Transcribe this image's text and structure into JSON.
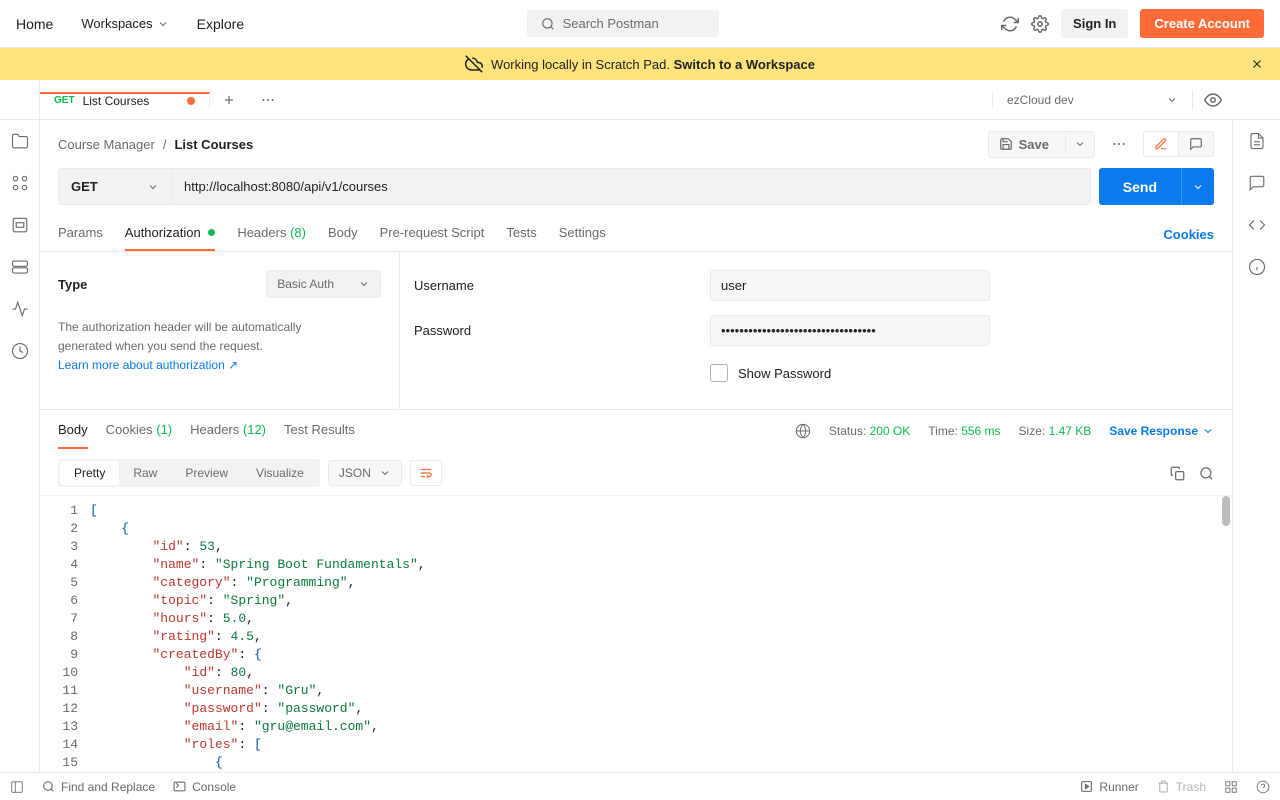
{
  "nav": {
    "home": "Home",
    "workspaces": "Workspaces",
    "explore": "Explore",
    "search_placeholder": "Search Postman",
    "signin": "Sign In",
    "create_account": "Create Account"
  },
  "banner": {
    "text": "Working locally in Scratch Pad.",
    "link": "Switch to a Workspace"
  },
  "tab": {
    "method": "GET",
    "title": "List Courses"
  },
  "env": {
    "name": "ezCloud dev"
  },
  "breadcrumb": {
    "parent": "Course Manager",
    "current": "List Courses"
  },
  "toolbar": {
    "save": "Save"
  },
  "request": {
    "method": "GET",
    "url": "http://localhost:8080/api/v1/courses",
    "send": "Send"
  },
  "reqTabs": {
    "params": "Params",
    "auth": "Authorization",
    "headers": "Headers",
    "headers_count": "(8)",
    "body": "Body",
    "prerequest": "Pre-request Script",
    "tests": "Tests",
    "settings": "Settings",
    "cookies": "Cookies"
  },
  "auth": {
    "type_label": "Type",
    "type_value": "Basic Auth",
    "desc1": "The authorization header will be automatically",
    "desc2": "generated when you send the request.",
    "learn": "Learn more about authorization ↗",
    "username_label": "Username",
    "username_value": "user",
    "password_label": "Password",
    "password_value": "••••••••••••••••••••••••••••••••••",
    "show_pw": "Show Password"
  },
  "respTabs": {
    "body": "Body",
    "cookies": "Cookies",
    "cookies_ct": "(1)",
    "headers": "Headers",
    "headers_ct": "(12)",
    "tests": "Test Results"
  },
  "respMeta": {
    "status_lbl": "Status:",
    "status_val": "200 OK",
    "time_lbl": "Time:",
    "time_val": "556 ms",
    "size_lbl": "Size:",
    "size_val": "1.47 KB",
    "save_response": "Save Response"
  },
  "respView": {
    "pretty": "Pretty",
    "raw": "Raw",
    "preview": "Preview",
    "visualize": "Visualize",
    "format": "JSON"
  },
  "footer": {
    "find": "Find and Replace",
    "console": "Console",
    "runner": "Runner",
    "trash": "Trash"
  },
  "json_response": [
    {
      "id": 53,
      "name": "Spring Boot Fundamentals",
      "category": "Programming",
      "topic": "Spring",
      "hours": 5.0,
      "rating": 4.5,
      "createdBy": {
        "id": 80,
        "username": "Gru",
        "password": "password",
        "email": "gru@email.com",
        "roles": []
      }
    }
  ],
  "json_lines": [
    "[",
    "    {",
    "        \"id\": 53,",
    "        \"name\": \"Spring Boot Fundamentals\",",
    "        \"category\": \"Programming\",",
    "        \"topic\": \"Spring\",",
    "        \"hours\": 5.0,",
    "        \"rating\": 4.5,",
    "        \"createdBy\": {",
    "            \"id\": 80,",
    "            \"username\": \"Gru\",",
    "            \"password\": \"password\",",
    "            \"email\": \"gru@email.com\",",
    "            \"roles\": [",
    "                {"
  ]
}
